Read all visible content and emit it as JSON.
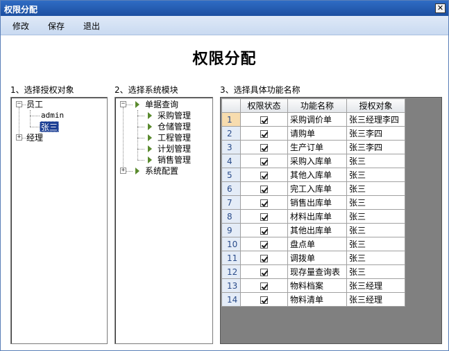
{
  "window": {
    "title": "权限分配",
    "close_label": "✕"
  },
  "menu": {
    "items": [
      {
        "label": "修改"
      },
      {
        "label": "保存"
      },
      {
        "label": "退出"
      }
    ]
  },
  "heading": "权限分配",
  "sections": {
    "object_label": "1、选择授权对象",
    "module_label": "2、选择系统模块",
    "function_label": "3、选择具体功能名称"
  },
  "tree_objects": {
    "nodes": [
      {
        "label": "员工",
        "expanded": true,
        "children": [
          {
            "label": "admin"
          },
          {
            "label": "张三",
            "selected": true
          }
        ]
      },
      {
        "label": "经理",
        "expanded": false
      }
    ]
  },
  "tree_modules": {
    "nodes": [
      {
        "label": "单据查询",
        "expanded": true,
        "children": [
          {
            "label": "采购管理"
          },
          {
            "label": "仓储管理"
          },
          {
            "label": "工程管理"
          },
          {
            "label": "计划管理"
          },
          {
            "label": "销售管理"
          }
        ]
      },
      {
        "label": "系统配置",
        "expanded": false
      }
    ]
  },
  "grid": {
    "columns": [
      "",
      "权限状态",
      "功能名称",
      "授权对象"
    ],
    "rows": [
      {
        "num": "1",
        "checked": true,
        "func": "采购调价单",
        "target": "张三经理李四"
      },
      {
        "num": "2",
        "checked": true,
        "func": "请购单",
        "target": "张三李四"
      },
      {
        "num": "3",
        "checked": true,
        "func": "生产订单",
        "target": "张三李四"
      },
      {
        "num": "4",
        "checked": true,
        "func": "采购入库单",
        "target": "张三"
      },
      {
        "num": "5",
        "checked": true,
        "func": "其他入库单",
        "target": "张三"
      },
      {
        "num": "6",
        "checked": true,
        "func": "完工入库单",
        "target": "张三"
      },
      {
        "num": "7",
        "checked": true,
        "func": "销售出库单",
        "target": "张三"
      },
      {
        "num": "8",
        "checked": true,
        "func": "材料出库单",
        "target": "张三"
      },
      {
        "num": "9",
        "checked": true,
        "func": "其他出库单",
        "target": "张三"
      },
      {
        "num": "10",
        "checked": true,
        "func": "盘点单",
        "target": "张三"
      },
      {
        "num": "11",
        "checked": true,
        "func": "调拨单",
        "target": "张三"
      },
      {
        "num": "12",
        "checked": true,
        "func": "现存量查询表",
        "target": "张三"
      },
      {
        "num": "13",
        "checked": true,
        "func": "物料档案",
        "target": "张三经理"
      },
      {
        "num": "14",
        "checked": true,
        "func": "物料清单",
        "target": "张三经理"
      }
    ]
  },
  "colors": {
    "title_bar": "#1c4fa0",
    "selection": "#1c3f94",
    "grid_background": "#808080",
    "tree_arrow": "#5a8a2e"
  }
}
